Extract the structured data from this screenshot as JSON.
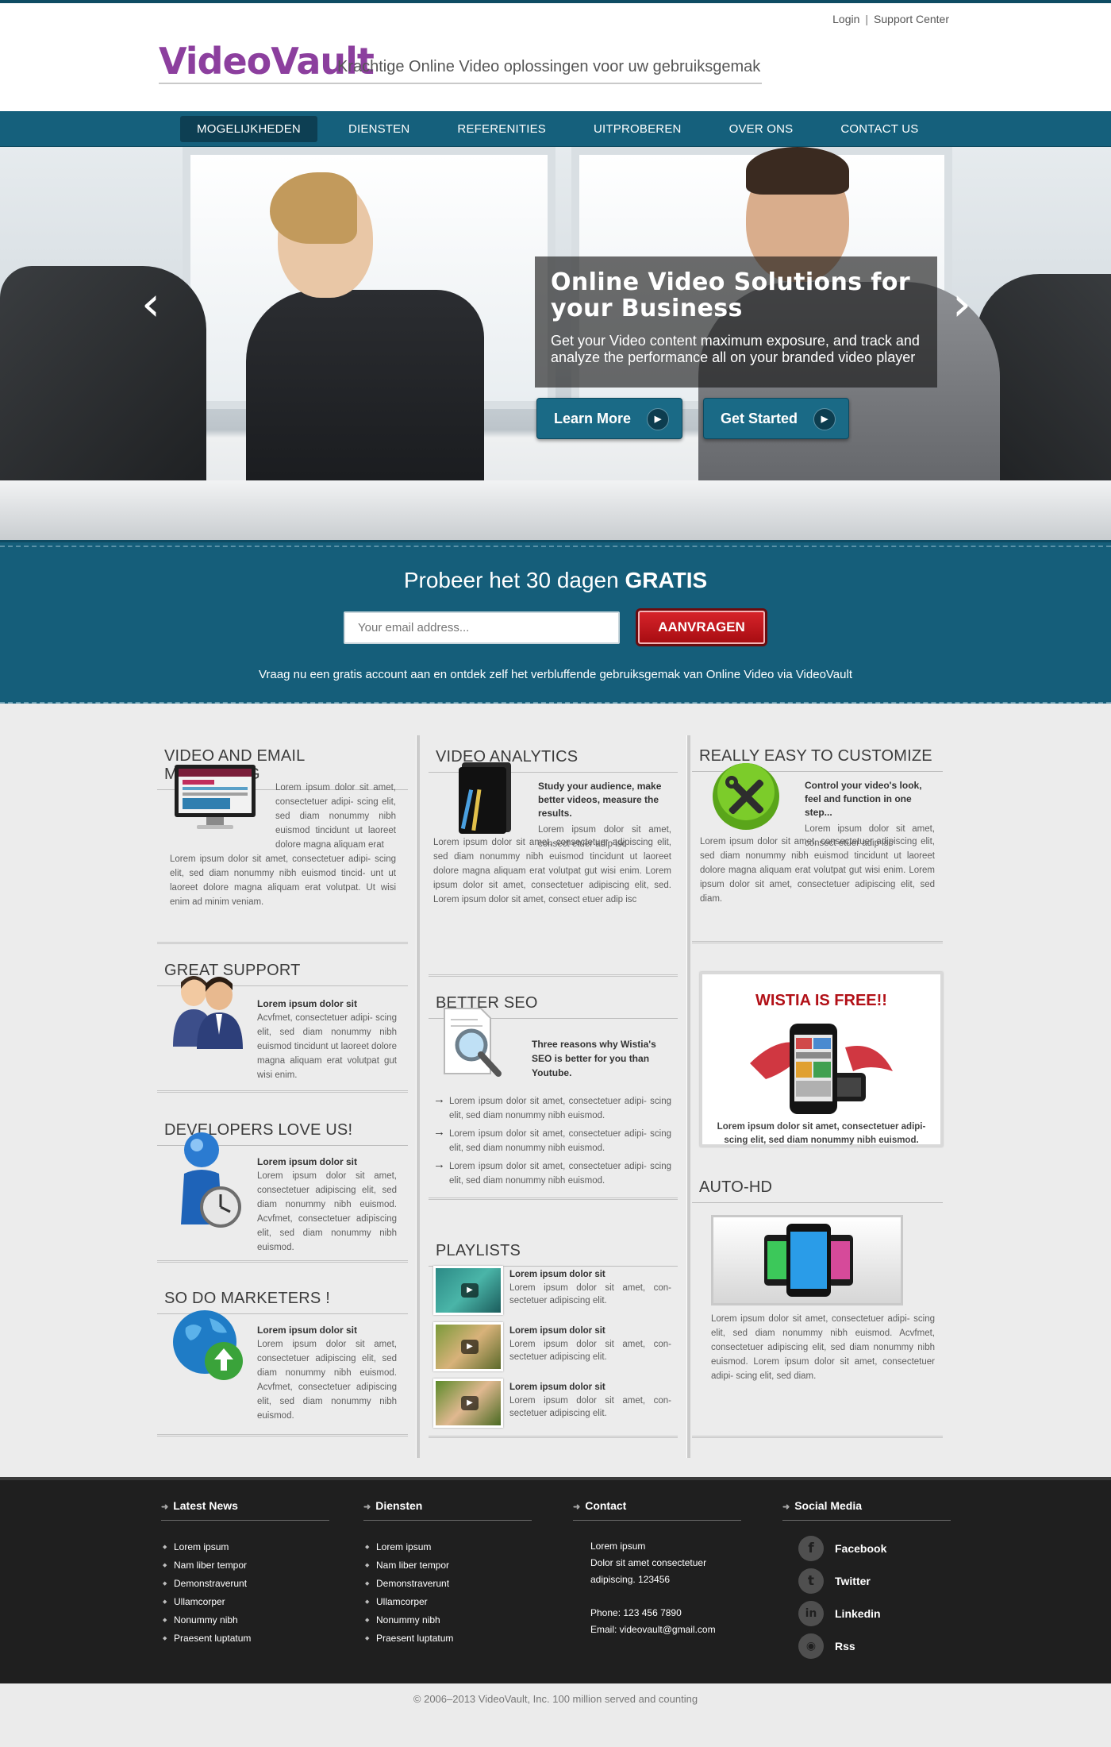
{
  "colors": {
    "brand": "#8c3f9e",
    "nav": "#15607c",
    "nav_active": "#0d3f53",
    "cta_red": "#c01a20",
    "footer_bg": "#1f1f1f"
  },
  "header": {
    "logo": "VideoVault",
    "tagline": "Krachtige Online Video oplossingen voor uw gebruiksgemak",
    "top_links": [
      "Login",
      "Support Center"
    ],
    "top_sep": "|"
  },
  "nav": {
    "items": [
      "MOGELIJKHEDEN",
      "DIENSTEN",
      "REFERENITIES",
      "UITPROBEREN",
      "OVER ONS",
      "CONTACT US"
    ],
    "active": "MOGELIJKHEDEN"
  },
  "hero": {
    "title": "Online Video Solutions for your Business",
    "text": "Get your Video content maximum exposure, and track and analyze the performance all on your branded video player",
    "btn_learn": "Learn More",
    "btn_start": "Get Started",
    "prev_icon": "chevron-left-icon",
    "next_icon": "chevron-right-icon"
  },
  "trial": {
    "title_prefix": "Probeer het 30 dagen",
    "title_bold": "GRATIS",
    "placeholder": "Your email address...",
    "button": "AANVRAGEN",
    "subtitle": "Vraag nu een gratis account aan en ontdek zelf het verbluffende gebruiksgemak van Online Video via VideoVault"
  },
  "col1": {
    "s1": {
      "title": "VIDEO AND EMAIL MARKETING",
      "text_side": "Lorem ipsum dolor sit amet, consectetuer adipi- scing elit, sed diam nonummy nibh euismod tincidunt ut laoreet dolore magna aliquam erat",
      "text_full": "Lorem ipsum dolor sit amet, consectetuer adipi- scing elit, sed diam nonummy nibh euismod tincid- unt ut laoreet dolore magna aliquam erat volutpat. Ut wisi enim ad minim veniam."
    },
    "s2": {
      "title": "GREAT SUPPORT",
      "bold": "Lorem ipsum dolor sit",
      "text": "Acvfmet, consectetuer adipi- scing elit, sed diam nonummy nibh euismod tincidunt ut laoreet dolore magna aliquam erat volutpat gut wisi enim."
    },
    "s3": {
      "title": "DEVELOPERS LOVE US!",
      "bold": "Lorem ipsum dolor sit",
      "text": "Lorem ipsum dolor sit amet, consectetuer adipiscing elit, sed diam nonummy nibh euismod. Acvfmet, consectetuer adipiscing elit, sed diam nonummy nibh euismod."
    },
    "s4": {
      "title": "SO DO MARKETERS !",
      "bold": "Lorem ipsum dolor sit",
      "text": "Lorem ipsum dolor sit amet, consectetuer adipiscing elit, sed diam nonummy nibh euismod. Acvfmet, consectetuer adipiscing elit, sed diam nonummy nibh euismod."
    }
  },
  "col2": {
    "s1": {
      "title": "VIDEO ANALYTICS",
      "bold": "Study your audience, make better videos, measure the results.",
      "text_side": "Lorem ipsum dolor sit amet, consect etuer adip isc",
      "text_full": "Lorem ipsum dolor sit amet, consectetuer adipiscing elit, sed diam nonummy nibh euismod tincidunt ut laoreet dolore magna aliquam erat volutpat gut wisi enim. Lorem ipsum dolor sit amet, consectetuer adipiscing elit, sed. Lorem ipsum dolor sit amet, consect etuer adip isc"
    },
    "s2": {
      "title": "BETTER SEO",
      "bold": "Three reasons why Wistia's SEO is better for you than Youtube.",
      "bullets": [
        "Lorem ipsum dolor sit amet, consectetuer adipi- scing elit, sed diam nonummy nibh euismod.",
        "Lorem ipsum dolor sit amet, consectetuer adipi- scing elit, sed diam nonummy nibh euismod.",
        "Lorem ipsum dolor sit amet, consectetuer adipi- scing elit, sed diam nonummy nibh euismod."
      ]
    },
    "s3": {
      "title": "PLAYLISTS",
      "items": [
        {
          "bold": "Lorem ipsum dolor sit",
          "text": "Lorem ipsum dolor sit amet, con- sectetuer adipiscing elit."
        },
        {
          "bold": "Lorem ipsum dolor sit",
          "text": "Lorem ipsum dolor sit amet, con- sectetuer adipiscing elit."
        },
        {
          "bold": "Lorem ipsum dolor sit",
          "text": "Lorem ipsum dolor sit amet, con- sectetuer adipiscing elit."
        }
      ]
    }
  },
  "col3": {
    "s1": {
      "title": "REALLY EASY TO CUSTOMIZE",
      "bold": "Control your video's look, feel and function in one step...",
      "text_side": "Lorem ipsum dolor sit amet, consect etuer adip isc",
      "text_full": "Lorem ipsum dolor sit amet, consectetuer adipiscing elit, sed diam nonummy nibh euismod tincidunt ut laoreet dolore magna aliquam erat volutpat gut wisi enim. Lorem ipsum dolor sit amet, consectetuer adipiscing elit, sed diam."
    },
    "promo": {
      "title": "WISTIA IS FREE!!",
      "text": "Lorem ipsum dolor sit amet, consectetuer adipi- scing elit, sed diam nonummy nibh euismod."
    },
    "s2": {
      "title": "AUTO-HD",
      "text": "Lorem ipsum dolor sit amet, consectetuer adipi- scing elit, sed diam nonummy nibh euismod. Acvfmet, consectetuer adipiscing elit, sed diam nonummy nibh euismod. Lorem ipsum dolor sit amet, consectetuer adipi- scing elit, sed diam."
    }
  },
  "footer": {
    "news": {
      "title": "Latest News",
      "items": [
        "Lorem ipsum",
        "Nam liber tempor",
        "Demonstraverunt",
        "Ullamcorper",
        "Nonummy nibh",
        "Praesent luptatum"
      ]
    },
    "diensten": {
      "title": "Diensten",
      "items": [
        "Lorem ipsum",
        "Nam liber tempor",
        "Demonstraverunt",
        "Ullamcorper",
        "Nonummy nibh",
        "Praesent luptatum"
      ]
    },
    "contact": {
      "title": "Contact",
      "line1": "Lorem ipsum",
      "line2": "Dolor sit amet consectetuer",
      "line3": "adipiscing. 123456",
      "phone": "Phone: 123 456 7890",
      "email": "Email: videovault@gmail.com"
    },
    "social": {
      "title": "Social Media",
      "items": [
        {
          "label": "Facebook",
          "glyph": "f",
          "icon": "facebook-icon"
        },
        {
          "label": "Twitter",
          "glyph": "t",
          "icon": "twitter-icon"
        },
        {
          "label": "Linkedin",
          "glyph": "in",
          "icon": "linkedin-icon"
        },
        {
          "label": "Rss",
          "glyph": "◉",
          "icon": "rss-icon"
        }
      ]
    },
    "copyright": "© 2006–2013 VideoVault, Inc. 100 million served and counting"
  }
}
